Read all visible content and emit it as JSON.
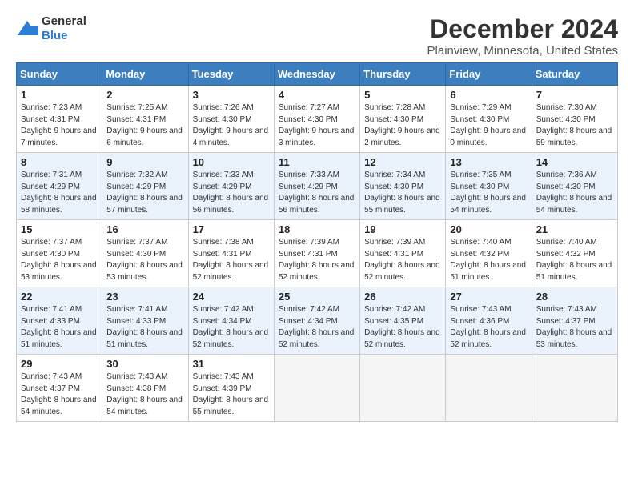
{
  "logo": {
    "general": "General",
    "blue": "Blue"
  },
  "title": "December 2024",
  "location": "Plainview, Minnesota, United States",
  "days_header": [
    "Sunday",
    "Monday",
    "Tuesday",
    "Wednesday",
    "Thursday",
    "Friday",
    "Saturday"
  ],
  "weeks": [
    [
      {
        "num": "1",
        "sunrise": "7:23 AM",
        "sunset": "4:31 PM",
        "daylight": "9 hours and 7 minutes."
      },
      {
        "num": "2",
        "sunrise": "7:25 AM",
        "sunset": "4:31 PM",
        "daylight": "9 hours and 6 minutes."
      },
      {
        "num": "3",
        "sunrise": "7:26 AM",
        "sunset": "4:30 PM",
        "daylight": "9 hours and 4 minutes."
      },
      {
        "num": "4",
        "sunrise": "7:27 AM",
        "sunset": "4:30 PM",
        "daylight": "9 hours and 3 minutes."
      },
      {
        "num": "5",
        "sunrise": "7:28 AM",
        "sunset": "4:30 PM",
        "daylight": "9 hours and 2 minutes."
      },
      {
        "num": "6",
        "sunrise": "7:29 AM",
        "sunset": "4:30 PM",
        "daylight": "9 hours and 0 minutes."
      },
      {
        "num": "7",
        "sunrise": "7:30 AM",
        "sunset": "4:30 PM",
        "daylight": "8 hours and 59 minutes."
      }
    ],
    [
      {
        "num": "8",
        "sunrise": "7:31 AM",
        "sunset": "4:29 PM",
        "daylight": "8 hours and 58 minutes."
      },
      {
        "num": "9",
        "sunrise": "7:32 AM",
        "sunset": "4:29 PM",
        "daylight": "8 hours and 57 minutes."
      },
      {
        "num": "10",
        "sunrise": "7:33 AM",
        "sunset": "4:29 PM",
        "daylight": "8 hours and 56 minutes."
      },
      {
        "num": "11",
        "sunrise": "7:33 AM",
        "sunset": "4:29 PM",
        "daylight": "8 hours and 56 minutes."
      },
      {
        "num": "12",
        "sunrise": "7:34 AM",
        "sunset": "4:30 PM",
        "daylight": "8 hours and 55 minutes."
      },
      {
        "num": "13",
        "sunrise": "7:35 AM",
        "sunset": "4:30 PM",
        "daylight": "8 hours and 54 minutes."
      },
      {
        "num": "14",
        "sunrise": "7:36 AM",
        "sunset": "4:30 PM",
        "daylight": "8 hours and 54 minutes."
      }
    ],
    [
      {
        "num": "15",
        "sunrise": "7:37 AM",
        "sunset": "4:30 PM",
        "daylight": "8 hours and 53 minutes."
      },
      {
        "num": "16",
        "sunrise": "7:37 AM",
        "sunset": "4:30 PM",
        "daylight": "8 hours and 53 minutes."
      },
      {
        "num": "17",
        "sunrise": "7:38 AM",
        "sunset": "4:31 PM",
        "daylight": "8 hours and 52 minutes."
      },
      {
        "num": "18",
        "sunrise": "7:39 AM",
        "sunset": "4:31 PM",
        "daylight": "8 hours and 52 minutes."
      },
      {
        "num": "19",
        "sunrise": "7:39 AM",
        "sunset": "4:31 PM",
        "daylight": "8 hours and 52 minutes."
      },
      {
        "num": "20",
        "sunrise": "7:40 AM",
        "sunset": "4:32 PM",
        "daylight": "8 hours and 51 minutes."
      },
      {
        "num": "21",
        "sunrise": "7:40 AM",
        "sunset": "4:32 PM",
        "daylight": "8 hours and 51 minutes."
      }
    ],
    [
      {
        "num": "22",
        "sunrise": "7:41 AM",
        "sunset": "4:33 PM",
        "daylight": "8 hours and 51 minutes."
      },
      {
        "num": "23",
        "sunrise": "7:41 AM",
        "sunset": "4:33 PM",
        "daylight": "8 hours and 51 minutes."
      },
      {
        "num": "24",
        "sunrise": "7:42 AM",
        "sunset": "4:34 PM",
        "daylight": "8 hours and 52 minutes."
      },
      {
        "num": "25",
        "sunrise": "7:42 AM",
        "sunset": "4:34 PM",
        "daylight": "8 hours and 52 minutes."
      },
      {
        "num": "26",
        "sunrise": "7:42 AM",
        "sunset": "4:35 PM",
        "daylight": "8 hours and 52 minutes."
      },
      {
        "num": "27",
        "sunrise": "7:43 AM",
        "sunset": "4:36 PM",
        "daylight": "8 hours and 52 minutes."
      },
      {
        "num": "28",
        "sunrise": "7:43 AM",
        "sunset": "4:37 PM",
        "daylight": "8 hours and 53 minutes."
      }
    ],
    [
      {
        "num": "29",
        "sunrise": "7:43 AM",
        "sunset": "4:37 PM",
        "daylight": "8 hours and 54 minutes."
      },
      {
        "num": "30",
        "sunrise": "7:43 AM",
        "sunset": "4:38 PM",
        "daylight": "8 hours and 54 minutes."
      },
      {
        "num": "31",
        "sunrise": "7:43 AM",
        "sunset": "4:39 PM",
        "daylight": "8 hours and 55 minutes."
      },
      null,
      null,
      null,
      null
    ]
  ]
}
